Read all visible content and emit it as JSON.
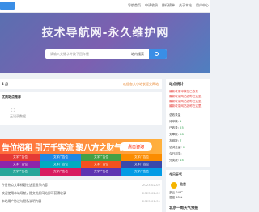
{
  "topbar": {
    "nav": [
      "导航首页",
      "申请收录",
      "排行榜单",
      "关于本站",
      "用户中心"
    ]
  },
  "hero": {
    "title": "技术导航网-永久维护网",
    "search_placeholder": "请输入关键字并按下回车键",
    "engine": "站内搜索"
  },
  "notice": {
    "left": "2 月",
    "right": "欢迎各大小站长提交网站"
  },
  "sidebar": {
    "heading": "站点统计",
    "red_lines": [
      "最新收录审核在已收录",
      "最新收录网站名称在这里",
      "最新收录网站名称在这里",
      "最新收录网站名称在这里"
    ],
    "stats": [
      {
        "label": "总收录量",
        "value": ""
      },
      {
        "label": "待审核:",
        "value": "1"
      },
      {
        "label": "已收录:",
        "value": "25"
      },
      {
        "label": "文章数:",
        "value": "28"
      },
      {
        "label": "友链数:",
        "value": "7"
      },
      {
        "label": "总浏览量:",
        "value": "1"
      },
      {
        "label": "今日浏览:",
        "value": ""
      },
      {
        "label": "分类数:",
        "value": "14"
      }
    ]
  },
  "panel1": {
    "heading": "优质站点推荐",
    "empty_text": "无记录数据..."
  },
  "banner": {
    "text": "告位招租 引万千客流 聚八方之财气",
    "button": "点击咨询"
  },
  "grid": {
    "cells": [
      {
        "label": "文字广告位",
        "color": "#e53935"
      },
      {
        "label": "文字广告位",
        "color": "#1e88e5"
      },
      {
        "label": "文字广告位",
        "color": "#43a047"
      },
      {
        "label": "文字广告位",
        "color": "#fb8c00"
      },
      {
        "label": "文字广告位",
        "color": "#8e24aa"
      },
      {
        "label": "文字广告位",
        "color": "#00acc1"
      },
      {
        "label": "文字广告位",
        "color": "#f4511e"
      },
      {
        "label": "文字广告位",
        "color": "#3949ab"
      },
      {
        "label": "文字广告位",
        "color": "#26a69a"
      },
      {
        "label": "文字广告位",
        "color": "#d81b60"
      },
      {
        "label": "文字广告位",
        "color": "#5e35b1"
      },
      {
        "label": "文字广告位",
        "color": "#039be5"
      }
    ]
  },
  "list": {
    "items": [
      {
        "text": "今日热点文章标题在这里显示内容",
        "date": "2023-02-02"
      },
      {
        "text": "欢迎使用本站导航，提交优质网站即可获得收录",
        "date": "2023-02-02"
      },
      {
        "text": "本站用户协议与隐私说明内容",
        "date": "2023-01-31"
      }
    ]
  },
  "weather": {
    "heading": "今日天气",
    "city": "北京",
    "line1": "多云 24℃",
    "line2": "湿度 45%",
    "foot": "北京一周天气预报"
  }
}
